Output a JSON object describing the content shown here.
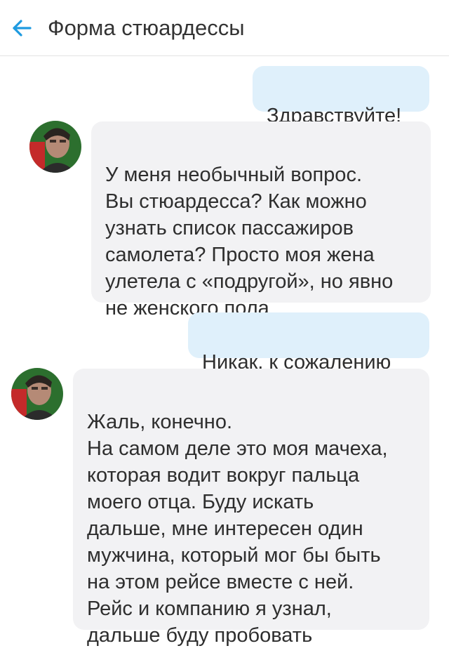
{
  "header": {
    "title": "Форма стюардессы",
    "back_icon": "arrow-left-icon",
    "accent_color": "#1e9ae0"
  },
  "messages": [
    {
      "side": "out",
      "text": "Здравствуйте!"
    },
    {
      "side": "in",
      "text": "У меня необычный вопрос.\nВы стюардесса? Как можно\nузнать список пассажиров\nсамолета? Просто моя жена\nулетела с «подругой», но явно\nне женского пола"
    },
    {
      "side": "out",
      "text": "Никак, к сожалению"
    },
    {
      "side": "in",
      "text": "Жаль, конечно.\nНа самом деле это моя мачеха,\nкоторая водит вокруг пальца\nмоего отца. Буду искать\nдальше, мне интересен один\nмужчина, который мог бы быть\nна этом рейсе вместе с ней.\nРейс и компанию я узнал,\nдальше буду пробовать"
    }
  ],
  "colors": {
    "outgoing_bubble": "#dff0fb",
    "incoming_bubble": "#f2f2f4"
  }
}
